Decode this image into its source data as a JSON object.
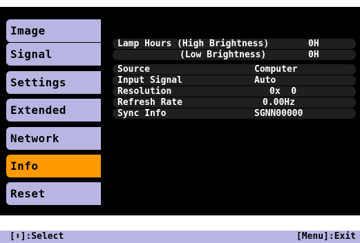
{
  "menu": [
    {
      "label": "Image"
    },
    {
      "label": "Signal"
    },
    {
      "label": "Settings"
    },
    {
      "label": "Extended"
    },
    {
      "label": "Network"
    },
    {
      "label": "Info",
      "active": true
    },
    {
      "label": "Reset"
    }
  ],
  "info": {
    "lamp_hours_high": {
      "label": "Lamp Hours (High Brightness)",
      "value": "0H"
    },
    "lamp_hours_low": {
      "label": "(Low Brightness)",
      "value": "0H"
    },
    "source": {
      "label": "Source",
      "value": "Computer"
    },
    "input_signal": {
      "label": "Input Signal",
      "value": "Auto"
    },
    "resolution": {
      "label": "Resolution",
      "value": "0x  0"
    },
    "refresh_rate": {
      "label": "Refresh Rate",
      "value": "0.00Hz"
    },
    "sync_info": {
      "label": "Sync Info",
      "value": "SGNN00000"
    }
  },
  "footer": {
    "left": "[⬍]:Select",
    "right": "[Menu]:Exit"
  },
  "colors": {
    "tab": "#b8b5e2",
    "active_tab": "#ff9a00",
    "background": "#000000"
  }
}
